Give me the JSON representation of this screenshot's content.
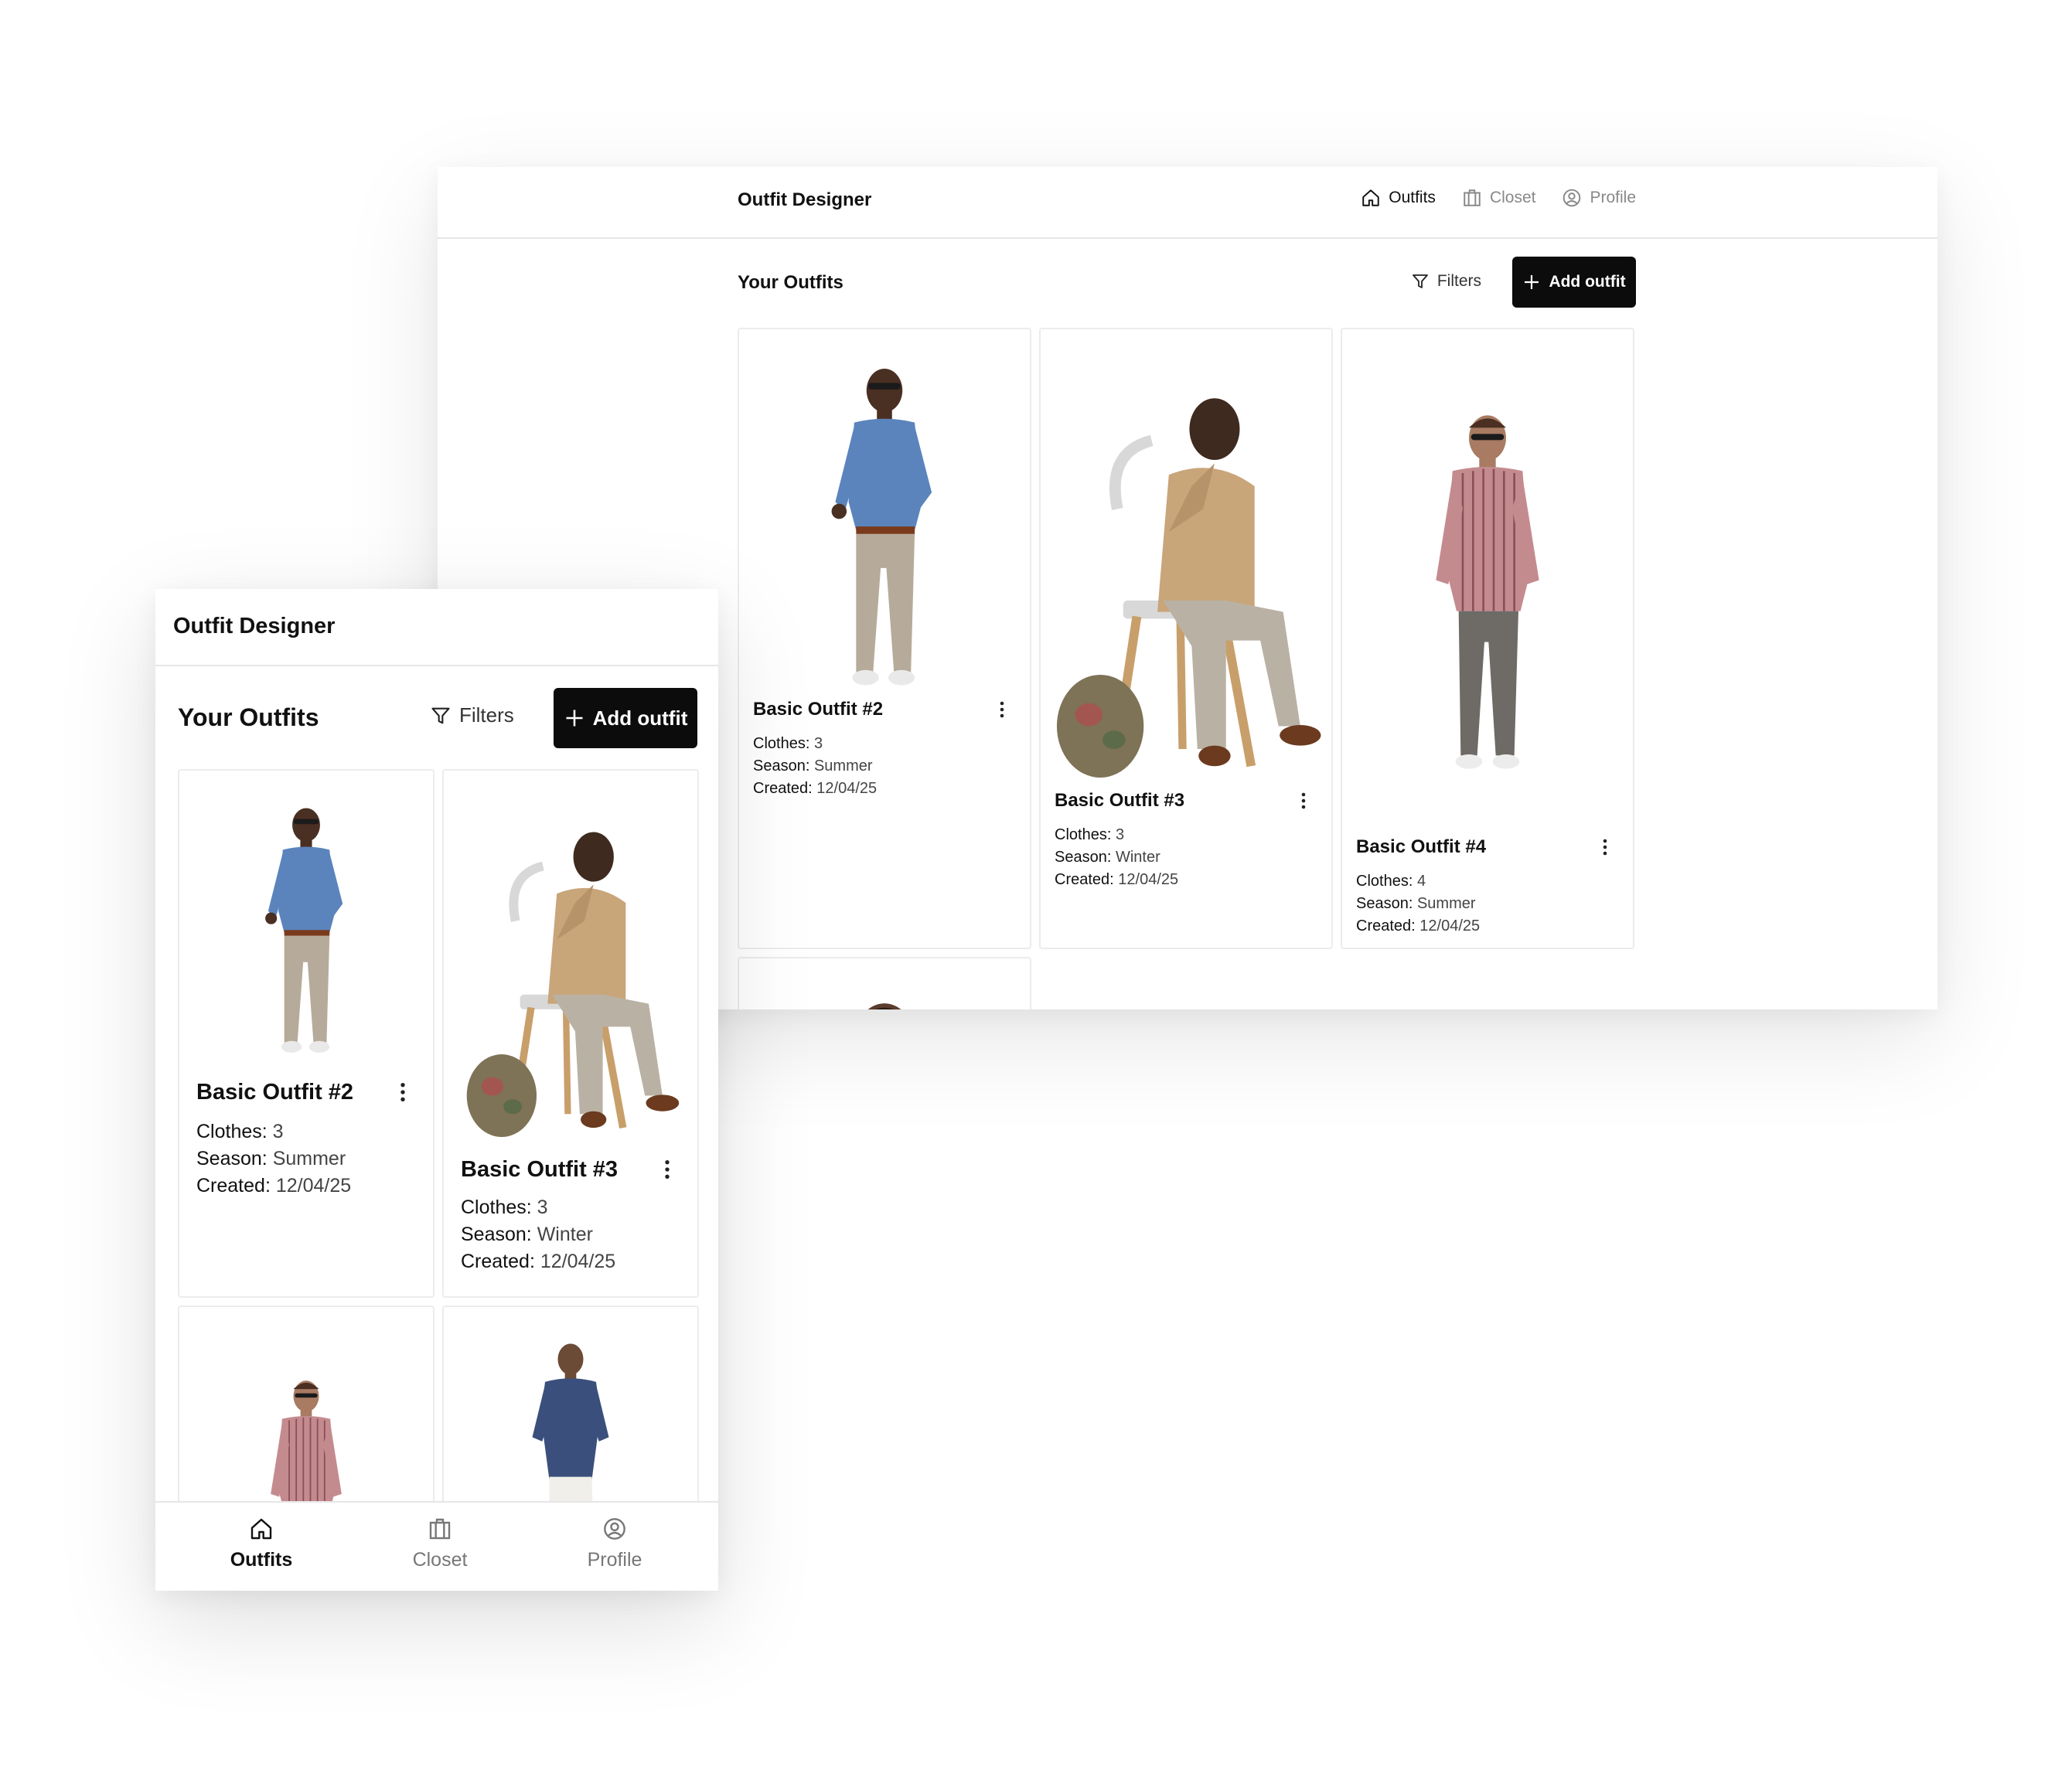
{
  "app": {
    "title": "Outfit Designer"
  },
  "nav": {
    "outfits": "Outfits",
    "closet": "Closet",
    "profile": "Profile"
  },
  "toolbar": {
    "heading": "Your Outfits",
    "filters": "Filters",
    "add_outfit": "Add outfit"
  },
  "labels": {
    "clothes": "Clothes:",
    "season": "Season:",
    "created": "Created:"
  },
  "outfits": [
    {
      "name": "Basic Outfit #2",
      "clothes": "3",
      "season": "Summer",
      "created": "12/04/25"
    },
    {
      "name": "Basic Outfit #3",
      "clothes": "3",
      "season": "Winter",
      "created": "12/04/25"
    },
    {
      "name": "Basic Outfit #4",
      "clothes": "4",
      "season": "Summer",
      "created": "12/04/25"
    }
  ],
  "colors": {
    "primary_button": "#0c0c0c",
    "border": "#ececec",
    "muted_text": "#888888"
  }
}
